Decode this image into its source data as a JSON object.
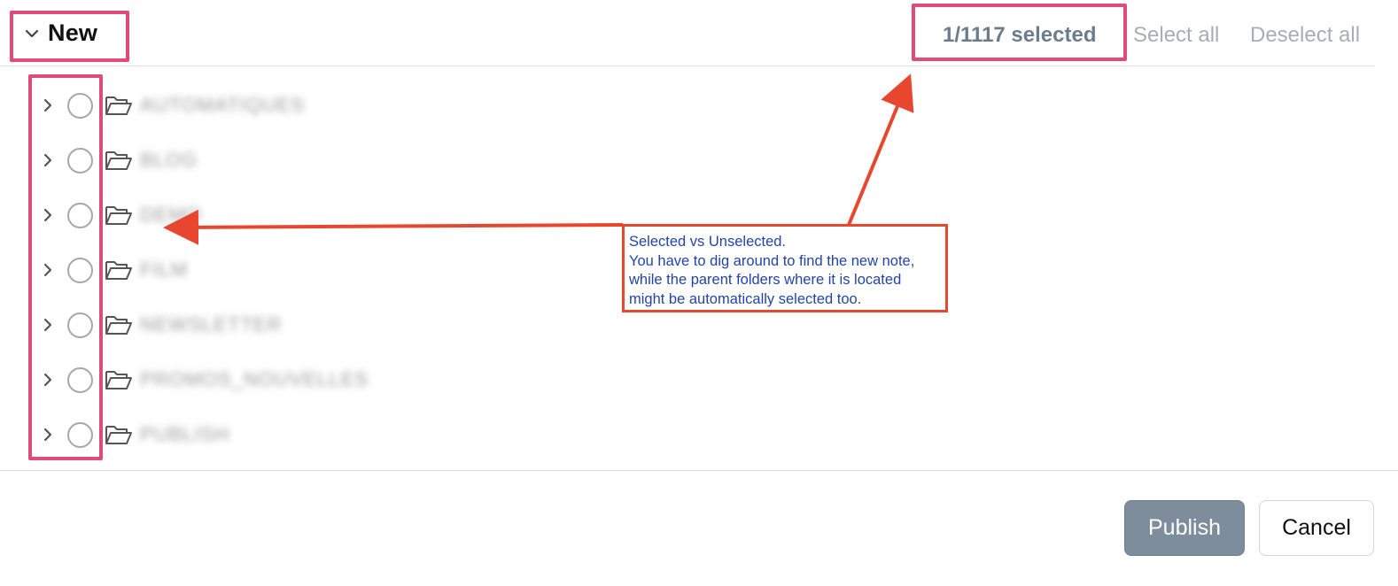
{
  "header": {
    "title": "New",
    "selected_count": "1/1117 selected",
    "select_all": "Select all",
    "deselect_all": "Deselect all"
  },
  "tree": {
    "rows": [
      {
        "label": "AUTOMATIQUES",
        "selected": false,
        "icon": "folder-open-icon"
      },
      {
        "label": "BLOG",
        "selected": false,
        "icon": "folder-open-icon"
      },
      {
        "label": "DEMO",
        "selected": false,
        "icon": "folder-open-icon"
      },
      {
        "label": "FILM",
        "selected": false,
        "icon": "folder-open-icon"
      },
      {
        "label": "NEWSLETTER",
        "selected": false,
        "icon": "folder-open-icon"
      },
      {
        "label": "PROMOS_NOUVELLES",
        "selected": false,
        "icon": "folder-open-icon"
      },
      {
        "label": "PUBLISH",
        "selected": false,
        "icon": "folder-open-icon"
      }
    ]
  },
  "annotation": {
    "lines": [
      "Selected vs Unselected.",
      "You have to dig around to find the new note,",
      "while the parent folders where it is located",
      "might be automatically selected too."
    ],
    "highlight_color": "#e04b77",
    "arrow_color": "#e8472f",
    "text_color": "#2344a6"
  },
  "footer": {
    "publish_label": "Publish",
    "cancel_label": "Cancel",
    "publish_color": "#7d8d9b"
  }
}
